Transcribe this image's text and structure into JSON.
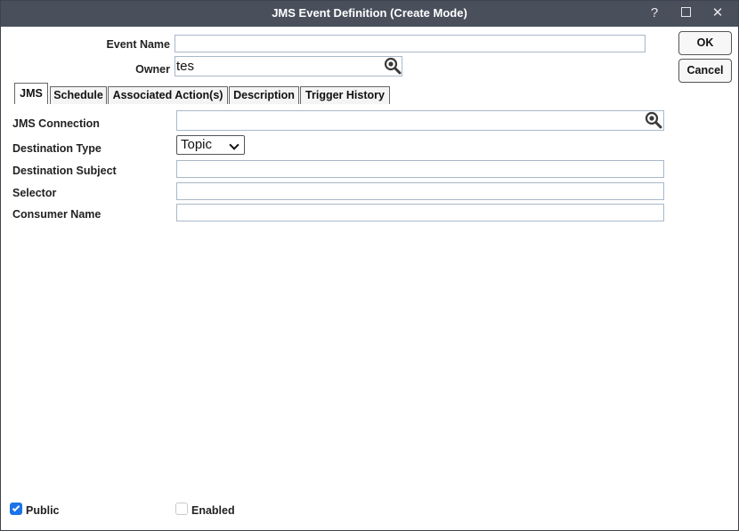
{
  "window": {
    "title": "JMS Event Definition (Create Mode)",
    "help_label": "?",
    "close_label": "✕"
  },
  "header_form": {
    "event_name_label": "Event Name",
    "event_name_value": "",
    "owner_label": "Owner",
    "owner_value": "tes"
  },
  "buttons": {
    "ok": "OK",
    "cancel": "Cancel"
  },
  "tabs": [
    {
      "label": "JMS",
      "active": true
    },
    {
      "label": "Schedule",
      "active": false
    },
    {
      "label": "Associated Action(s)",
      "active": false
    },
    {
      "label": "Description",
      "active": false
    },
    {
      "label": "Trigger History",
      "active": false
    }
  ],
  "jms_form": {
    "connection_label": "JMS Connection",
    "connection_value": "",
    "destination_type_label": "Destination Type",
    "destination_type_value": "Topic",
    "destination_subject_label": "Destination Subject",
    "destination_subject_value": "",
    "selector_label": "Selector",
    "selector_value": "",
    "consumer_name_label": "Consumer Name",
    "consumer_name_value": ""
  },
  "footer": {
    "public_label": "Public",
    "public_checked": true,
    "enabled_label": "Enabled",
    "enabled_checked": false
  },
  "colors": {
    "titlebar": "#4a4f5c",
    "checkbox_accent": "#1a73e8",
    "field_border": "#a8b8c8"
  }
}
